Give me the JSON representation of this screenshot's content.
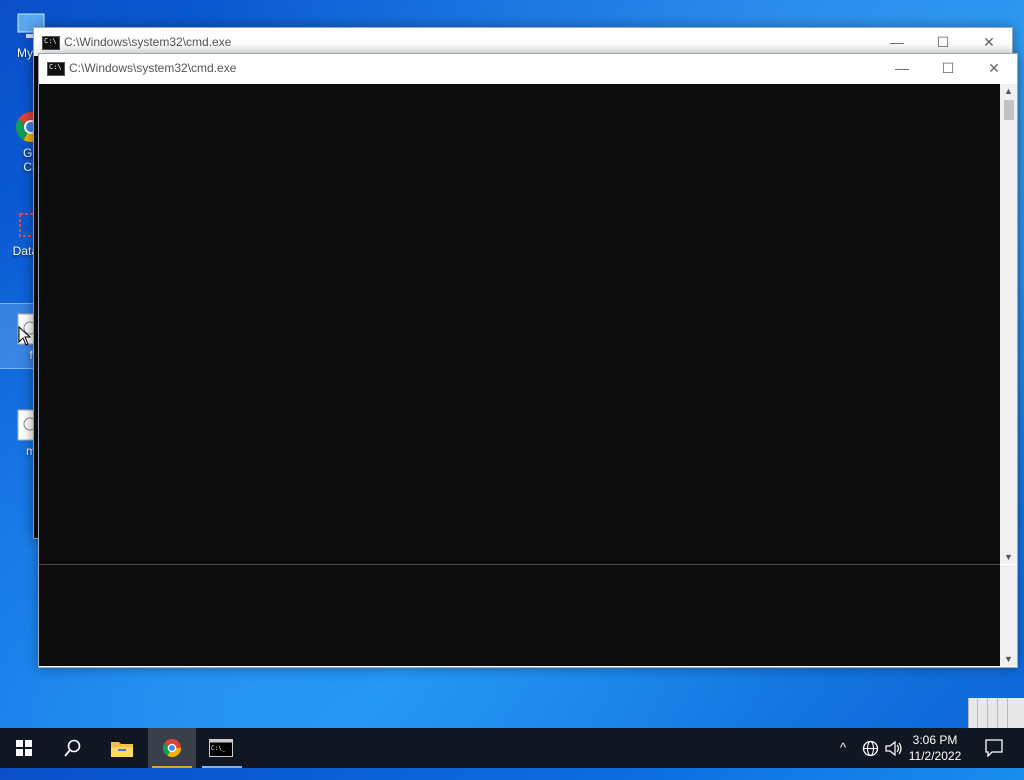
{
  "desktop": {
    "icons": [
      {
        "label": "My C"
      },
      {
        "label": "Go\nCh"
      },
      {
        "label": "DataW"
      },
      {
        "label": "f"
      },
      {
        "label": "m"
      }
    ]
  },
  "windows": {
    "back": {
      "title": "C:\\Windows\\system32\\cmd.exe"
    },
    "front": {
      "title": "C:\\Windows\\system32\\cmd.exe"
    },
    "controls": {
      "minimize": "—",
      "maximize": "☐",
      "close": "✕"
    }
  },
  "taskbar": {
    "start_icon": "windows-logo-icon",
    "search_icon": "search-icon",
    "apps": [
      "file-explorer-icon",
      "chrome-icon",
      "cmd-icon"
    ],
    "tray": {
      "chevron": "^",
      "network_icon": "globe-icon",
      "volume_icon": "speaker-icon"
    },
    "time": "3:06 PM",
    "date": "11/2/2022",
    "notification_icon": "action-center-icon",
    "accent": "#7eb4ea"
  }
}
